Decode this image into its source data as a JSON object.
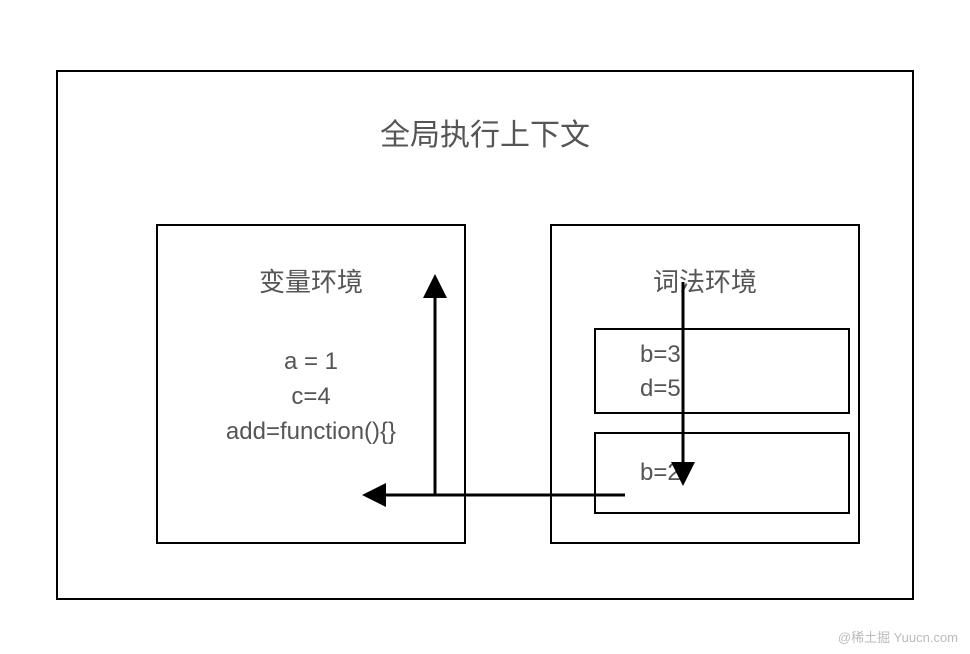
{
  "diagram": {
    "title": "全局执行上下文",
    "left": {
      "title": "变量环境",
      "lines": [
        "a = 1",
        "c=4",
        "add=function(){}"
      ]
    },
    "right": {
      "title": "词法环境",
      "topBox": [
        "b=3",
        "d=5"
      ],
      "bottomBox": [
        "b=2"
      ]
    }
  },
  "watermark": "@稀土掘 Yuucn.com"
}
